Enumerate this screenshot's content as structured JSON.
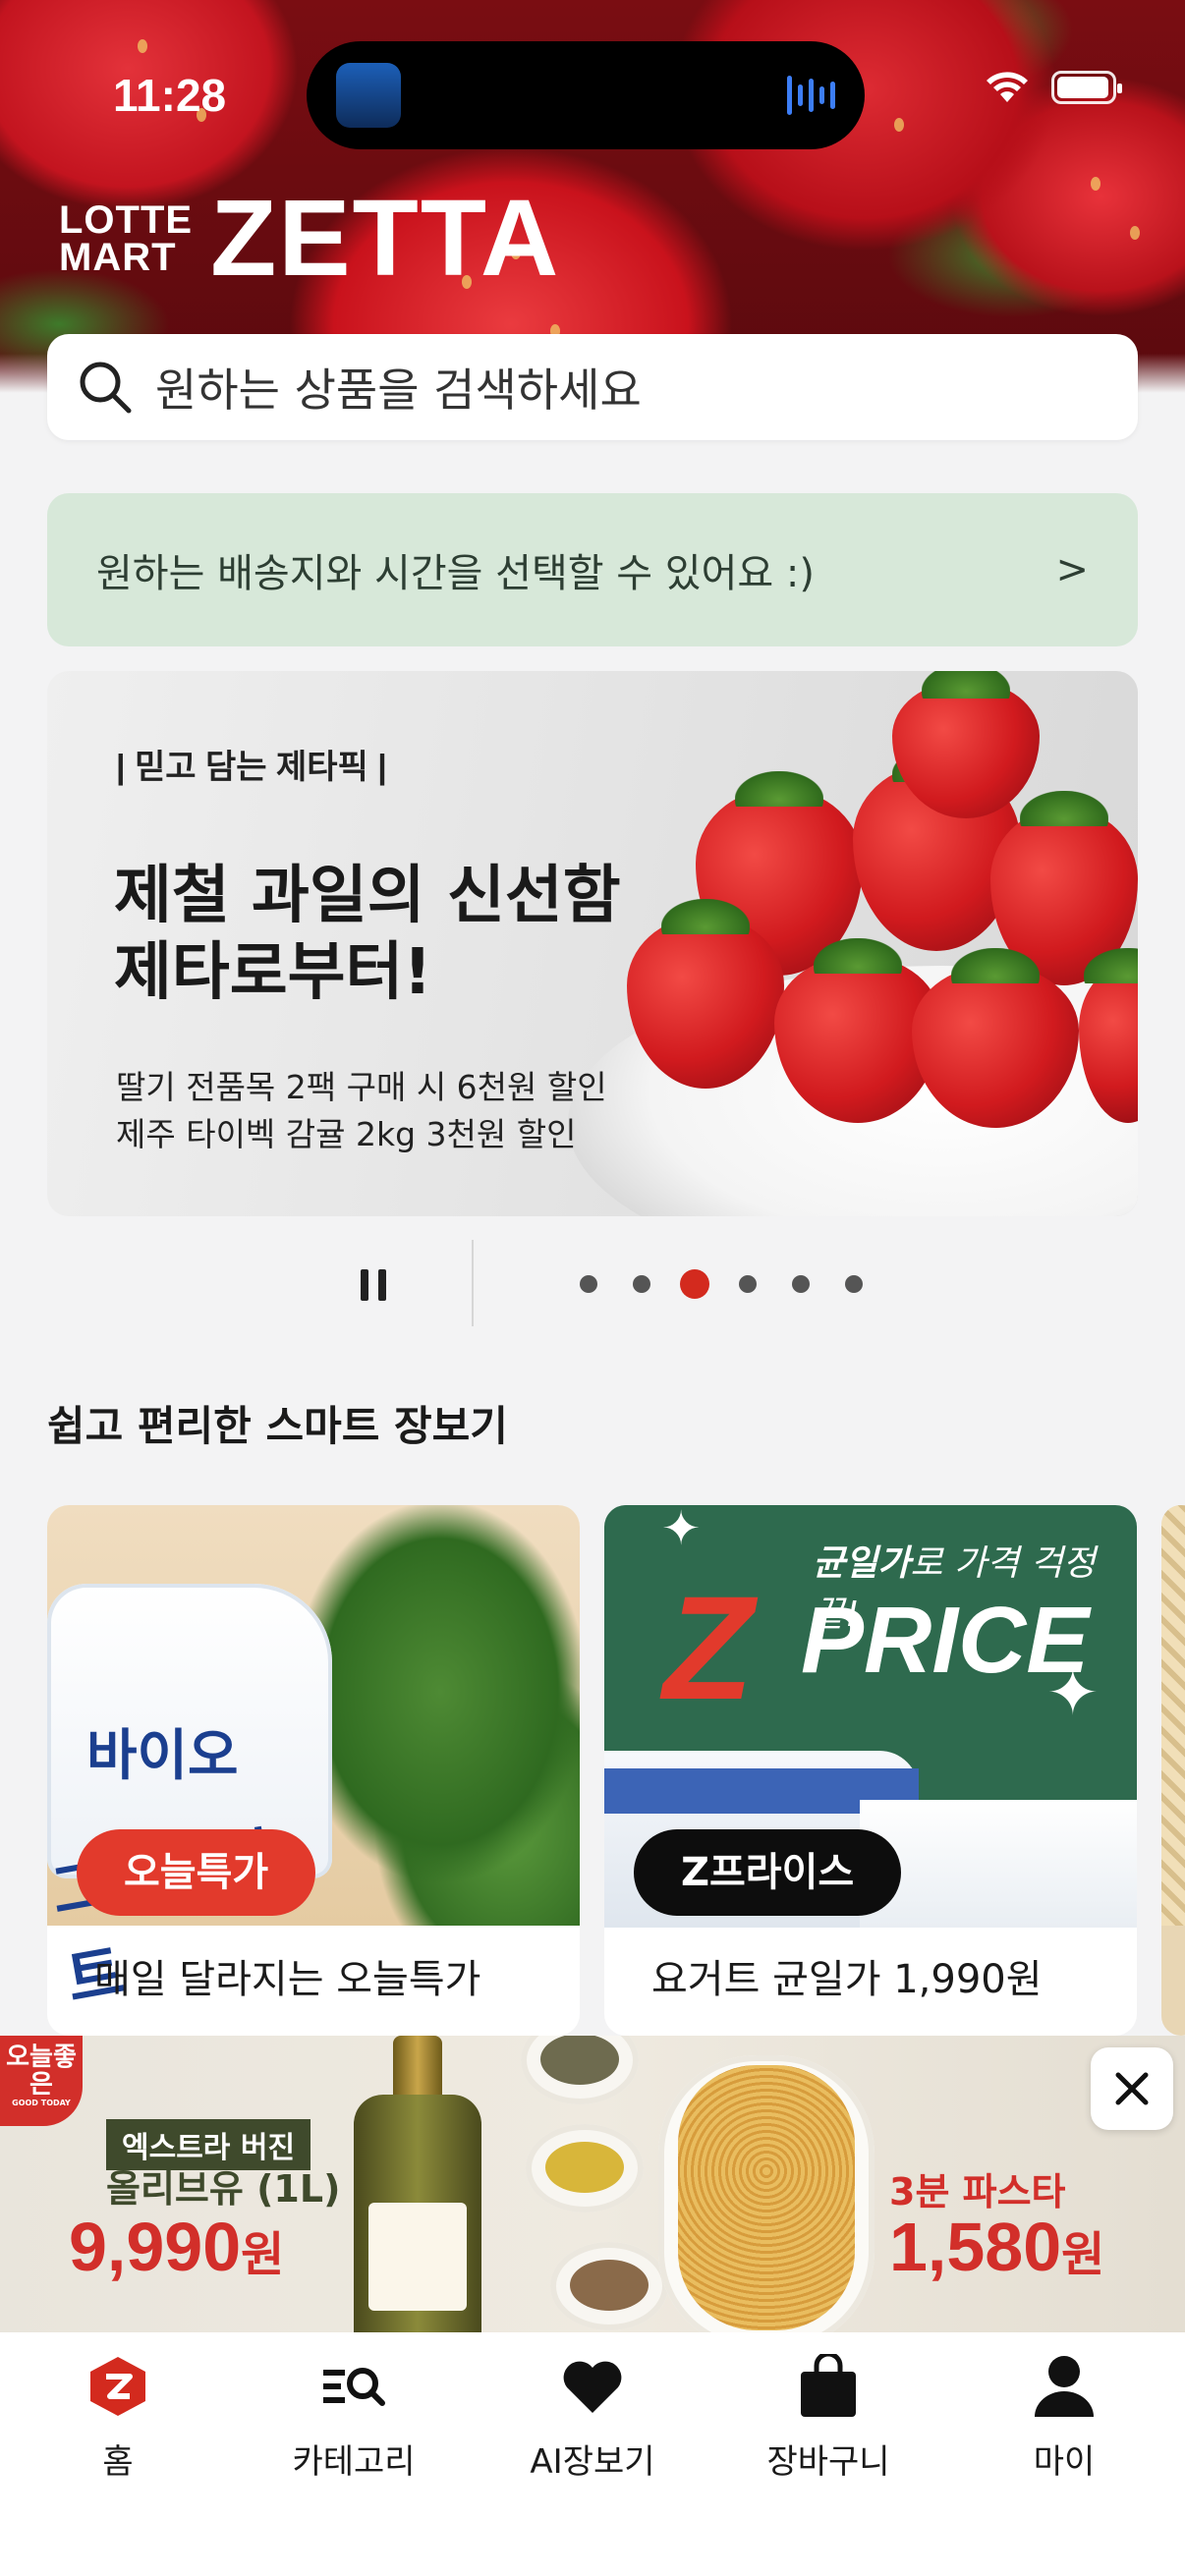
{
  "status_bar": {
    "time": "11:28"
  },
  "header": {
    "logo_small_top": "LOTTE",
    "logo_small_bottom": "MART",
    "logo_big": "ZETTA"
  },
  "search": {
    "placeholder": "원하는 상품을 검색하세요"
  },
  "delivery_banner": {
    "text": "원하는 배송지와 시간을 선택할 수 있어요 :)",
    "arrow": ">"
  },
  "main_banner": {
    "tag": "| 믿고 담는 제타픽 |",
    "title_line1": "제철 과일의 신선함",
    "title_line2": "제타로부터!",
    "sub_line1": "딸기 전품목 2팩 구매 시 6천원 할인",
    "sub_line2": "제주 타이벡 감귤 2kg 3천원 할인"
  },
  "carousel": {
    "total": 6,
    "active_index": 2
  },
  "smart_section": {
    "title": "쉽고 편리한 스마트 장보기",
    "cards": [
      {
        "pill": "오늘특가",
        "caption": "매일 달라지는 오늘특가",
        "product_text_1": "바이오",
        "product_text_2": "그릭요거트"
      },
      {
        "pill": "Z프라이스",
        "caption": "요거트 균일가 1,990원",
        "slogan_bold": "균일가",
        "slogan_rest": "로 가격 걱정 끝!",
        "logo_z": "Z",
        "logo_price": "PRICE"
      }
    ]
  },
  "ad": {
    "badge": "오늘좋은",
    "badge_small": "GOOD TODAY",
    "left_tag": "엑스트라 버진",
    "left_name": "올리브유 (1L)",
    "left_price": "9,990",
    "left_unit": "원",
    "right_name": "3분 파스타",
    "right_price": "1,580",
    "right_unit": "원"
  },
  "tabbar": {
    "items": [
      {
        "label": "홈",
        "icon": "home-z-icon"
      },
      {
        "label": "카테고리",
        "icon": "category-search-icon"
      },
      {
        "label": "AI장보기",
        "icon": "heart-icon"
      },
      {
        "label": "장바구니",
        "icon": "shopping-bag-icon"
      },
      {
        "label": "마이",
        "icon": "person-icon"
      }
    ]
  },
  "colors": {
    "brand_red": "#d32a1e",
    "delivery_bg": "#d7e8d9",
    "zprice_green": "#2e6a4e"
  }
}
